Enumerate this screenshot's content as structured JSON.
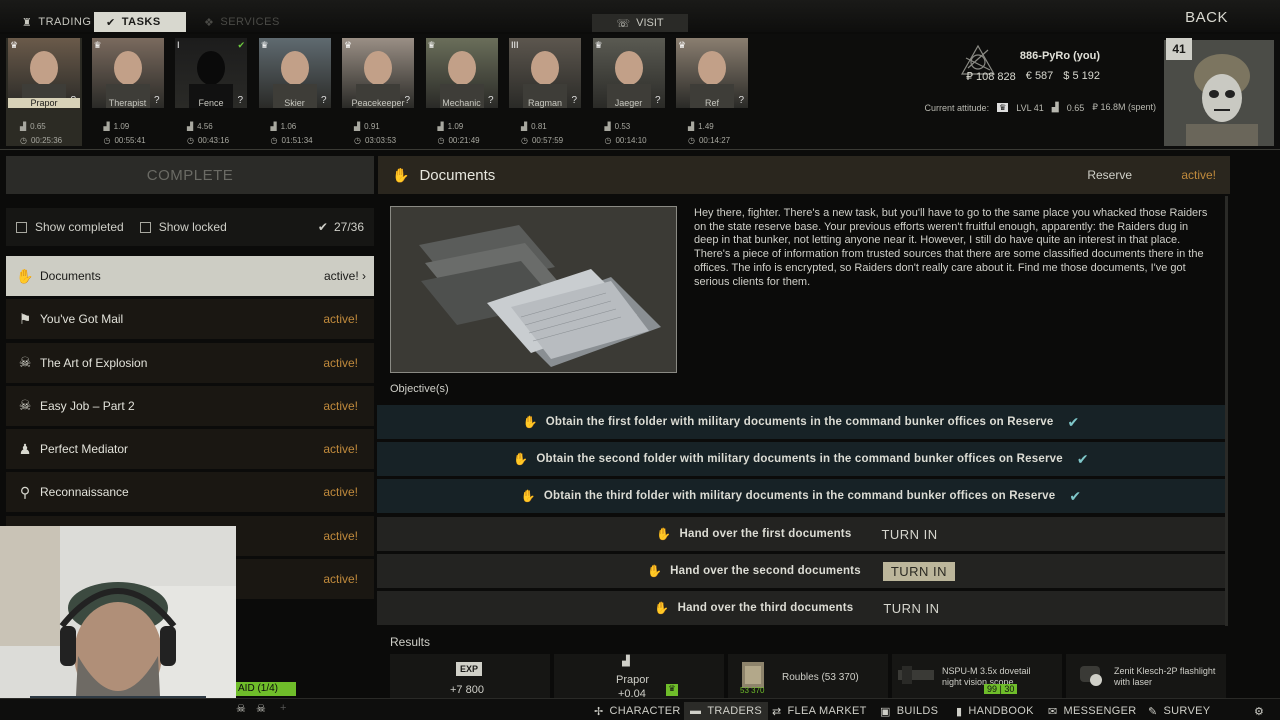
{
  "top": {
    "tabs": [
      {
        "label": "TRADING"
      },
      {
        "label": "TASKS"
      },
      {
        "label": "SERVICES"
      }
    ],
    "visit_label": "VISIT",
    "back_label": "BACK"
  },
  "traders": [
    {
      "name": "Prapor",
      "rep": "0.65",
      "timer": "00:25:36"
    },
    {
      "name": "Therapist",
      "rep": "1.09",
      "timer": "00:55:41"
    },
    {
      "name": "Fence",
      "rep": "4.56",
      "timer": "00:43:16"
    },
    {
      "name": "Skier",
      "rep": "1.06",
      "timer": "01:51:34"
    },
    {
      "name": "Peacekeeper",
      "rep": "0.91",
      "timer": "03:03:53"
    },
    {
      "name": "Mechanic",
      "rep": "1.09",
      "timer": "00:21:49"
    },
    {
      "name": "Ragman",
      "rep": "0.81",
      "timer": "00:57:59"
    },
    {
      "name": "Jaeger",
      "rep": "0.53",
      "timer": "00:14:10"
    },
    {
      "name": "Ref",
      "rep": "1.49",
      "timer": "00:14:27"
    }
  ],
  "player": {
    "name": "886-PyRo (you)",
    "level": "41",
    "roubles": "₽ 108 828",
    "euros": "€ 587",
    "dollars": "$ 5 192",
    "attitude_label": "Current attitude:",
    "attitude_level": "LVL 41",
    "attitude_rep": "0.65",
    "attitude_spent": "₽ 16.8M (spent)"
  },
  "left": {
    "complete_label": "COMPLETE",
    "show_completed": "Show completed",
    "show_locked": "Show locked",
    "count": "27/36",
    "tasks": [
      {
        "title": "Documents",
        "status": "active!",
        "icon": "hand-icon"
      },
      {
        "title": "You've Got Mail",
        "status": "active!",
        "icon": "run-icon"
      },
      {
        "title": "The Art of Explosion",
        "status": "active!",
        "icon": "skull-icon"
      },
      {
        "title": "Easy Job – Part 2",
        "status": "active!",
        "icon": "skull-icon"
      },
      {
        "title": "Perfect Mediator",
        "status": "active!",
        "icon": "bulb-icon"
      },
      {
        "title": "Reconnaissance",
        "status": "active!",
        "icon": "search-icon"
      },
      {
        "title": "",
        "status": "active!",
        "icon": "none"
      },
      {
        "title": "",
        "status": "active!",
        "icon": "none"
      }
    ]
  },
  "task": {
    "title": "Documents",
    "location": "Reserve",
    "status": "active!",
    "description": "Hey there, fighter. There's a new task, but you'll have to go to the same place you whacked those Raiders on the state reserve base. Your previous efforts weren't fruitful enough, apparently: the Raiders dug in deep in that bunker, not letting anyone near it. However, I still do have quite an interest in that place. There's a piece of information from trusted sources that there are some classified documents there in the offices. The info is encrypted, so Raiders don't really care about it. Find me those documents, I've got serious clients for them.",
    "objectives_label": "Objective(s)",
    "objectives": [
      {
        "text": "Obtain the first folder with military documents in the command bunker offices on Reserve",
        "done": true
      },
      {
        "text": "Obtain the second folder with military documents in the command bunker offices on Reserve",
        "done": true
      },
      {
        "text": "Obtain the third folder with military documents in the command bunker offices on Reserve",
        "done": true
      },
      {
        "text": "Hand over the first documents",
        "done": false,
        "action": "TURN IN"
      },
      {
        "text": "Hand over the second documents",
        "done": false,
        "action": "TURN IN"
      },
      {
        "text": "Hand over the third documents",
        "done": false,
        "action": "TURN IN"
      }
    ],
    "results_label": "Results",
    "results": {
      "exp_badge": "EXP",
      "exp_value": "+7 800",
      "rep_trader": "Prapor",
      "rep_value": "+0.04",
      "roubles_label": "Roubles (53 370)",
      "roubles_small": "53 370",
      "item1": "NSPU-M 3.5x dovetail night vision scope",
      "item1_badge": "99 | 30",
      "item2": "Zenit Klesch-2P flashlight with laser"
    }
  },
  "raid_label": "AID (1/4)",
  "bottomnav": [
    {
      "label": "CHARACTER"
    },
    {
      "label": "TRADERS"
    },
    {
      "label": "FLEA MARKET"
    },
    {
      "label": "BUILDS"
    },
    {
      "label": "HANDBOOK"
    },
    {
      "label": "MESSENGER"
    },
    {
      "label": "SURVEY"
    }
  ],
  "colors": {
    "accent_active": "#c08a3c",
    "objective_done_bg": "#172226",
    "check": "#7fc7c9",
    "raid_green": "#6fbd2a"
  }
}
